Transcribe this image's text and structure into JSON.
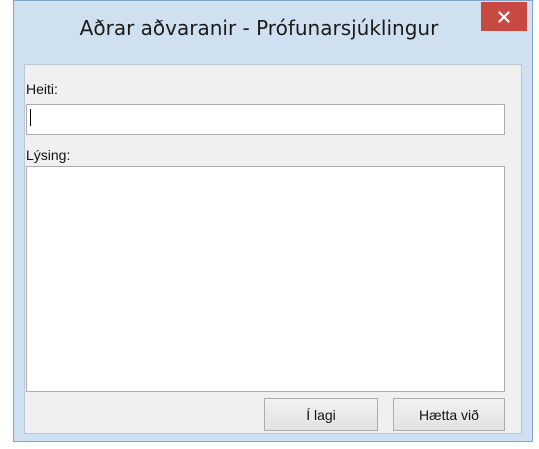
{
  "window": {
    "title": "Aðrar aðvaranir - Prófunarsjúklingur",
    "close_icon": "close-icon"
  },
  "form": {
    "name_label": "Heiti:",
    "name_value": "",
    "description_label": "Lýsing:",
    "description_value": ""
  },
  "buttons": {
    "ok_label": "Í lagi",
    "cancel_label": "Hætta við"
  },
  "colors": {
    "title_bar": "#cfe0f0",
    "close_button": "#c74a41",
    "dialog_body": "#f0f0f0"
  }
}
